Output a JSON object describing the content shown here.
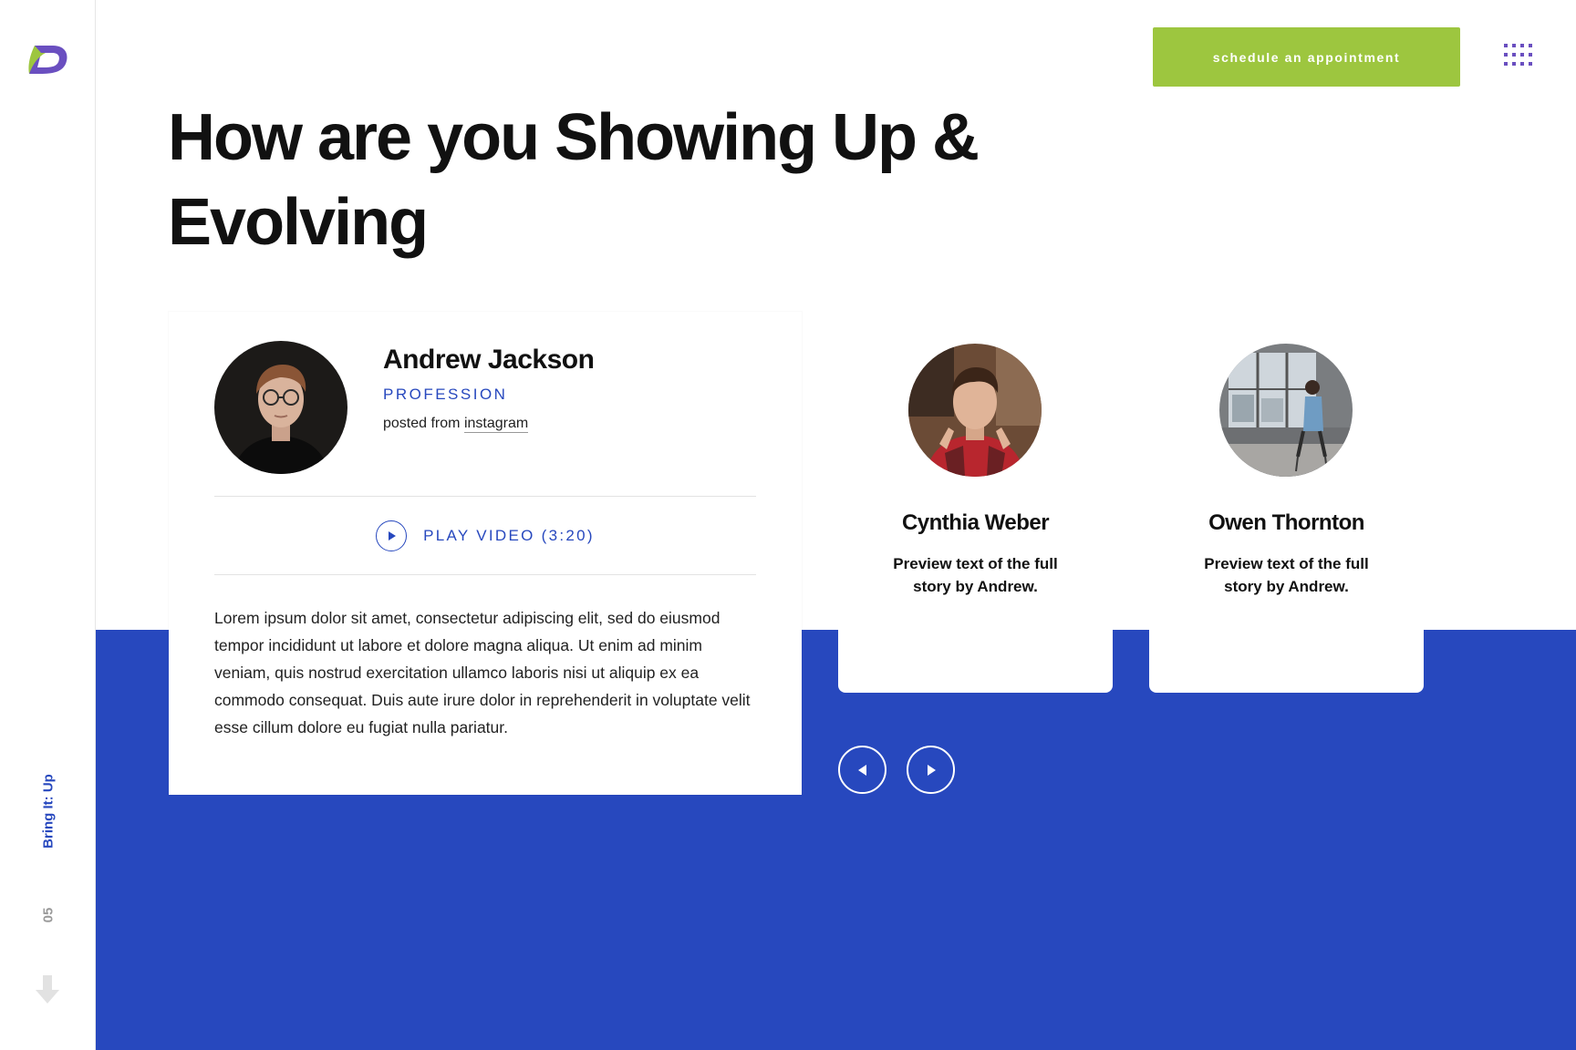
{
  "brand": {
    "logo_icon": "brand-logo-icon",
    "accent": "#9dc63f",
    "primary": "#2748be",
    "secondary": "#6a4fc0"
  },
  "header": {
    "cta_label": "schedule an appointment",
    "menu_icon": "grid-menu-icon"
  },
  "hero": {
    "title": "How are you Showing Up & Evolving"
  },
  "featured": {
    "name": "Andrew Jackson",
    "profession": "PROFESSION",
    "posted_prefix": "posted from",
    "posted_source": "instagram",
    "play_label": "PLAY VIDEO (3:20)",
    "body": "Lorem ipsum dolor sit amet, consectetur adipiscing elit, sed do eiusmod tempor incididunt ut labore et dolore magna aliqua. Ut enim ad minim veniam, quis nostrud exercitation ullamco laboris nisi ut aliquip ex ea commodo consequat. Duis aute irure dolor in reprehenderit in voluptate velit esse cillum dolore eu fugiat nulla pariatur."
  },
  "stories": [
    {
      "name": "Cynthia Weber",
      "preview": "Preview text of the full story by Andrew."
    },
    {
      "name": "Owen Thornton",
      "preview": "Preview text of the full story by Andrew."
    }
  ],
  "sidebar": {
    "section_label": "Bring It: Up",
    "section_number": "05",
    "scroll_icon": "arrow-down-icon"
  },
  "carousel": {
    "prev_icon": "arrow-left-icon",
    "next_icon": "arrow-right-icon"
  }
}
